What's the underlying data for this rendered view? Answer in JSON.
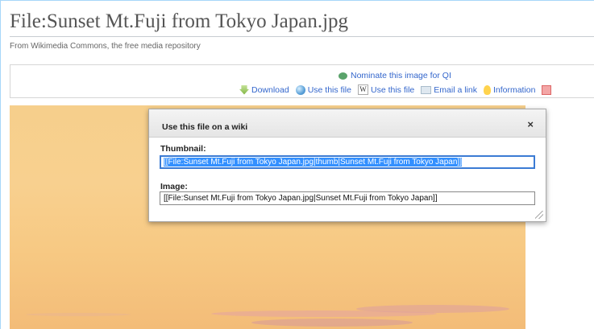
{
  "page": {
    "title": "File:Sunset Mt.Fuji from Tokyo Japan.jpg",
    "tagline": "From Wikimedia Commons, the free media repository"
  },
  "toolbar": {
    "nominate_label": "Nominate this image for QI",
    "download_label": "Download",
    "use_this_file_label": "Use this file",
    "use_this_file_wiki_label": "Use this file",
    "email_link_label": "Email a link",
    "information_label": "Information"
  },
  "dialog": {
    "title": "Use this file on a wiki",
    "close_label": "×",
    "thumbnail_label": "Thumbnail:",
    "thumbnail_value": "[[File:Sunset Mt.Fuji from Tokyo Japan.jpg|thumb|Sunset Mt.Fuji from Tokyo Japan]]",
    "image_label": "Image:",
    "image_value": "[[File:Sunset Mt.Fuji from Tokyo Japan.jpg|Sunset Mt.Fuji from Tokyo Japan]]"
  },
  "icons": {
    "nominate": "qi-leaf-icon",
    "download": "download-icon",
    "use_file": "globe-icon",
    "use_file_wiki": "wikipedia-w-icon",
    "email": "email-icon",
    "information": "lightbulb-icon",
    "extra": "red-square-icon"
  },
  "colors": {
    "link": "#3366cc",
    "selection": "#3390ff",
    "focus_border": "#3b7bd4"
  }
}
